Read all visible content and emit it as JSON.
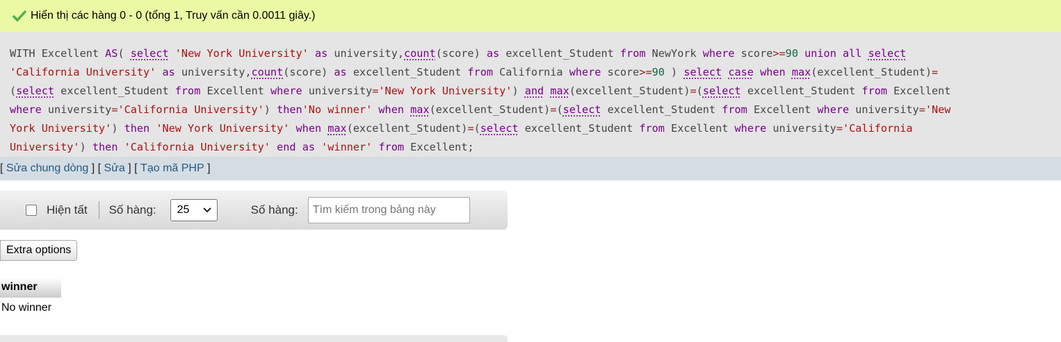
{
  "success_message": "Hiển thị các hàng 0 - 0 (tổng 1, Truy vấn cần 0.0011 giây.)",
  "sql_lines": [
    [
      [
        "p",
        "WITH Excellent "
      ],
      [
        "k",
        "AS"
      ],
      [
        "p",
        "( "
      ],
      [
        "f",
        "select"
      ],
      [
        "p",
        " "
      ],
      [
        "s",
        "'New York University'"
      ],
      [
        "p",
        " "
      ],
      [
        "k",
        "as"
      ],
      [
        "p",
        " university,"
      ],
      [
        "f",
        "count"
      ],
      [
        "p",
        "(score) "
      ],
      [
        "k",
        "as"
      ],
      [
        "p",
        " excellent_Student "
      ],
      [
        "k",
        "from"
      ],
      [
        "p",
        " NewYork "
      ],
      [
        "k",
        "where"
      ],
      [
        "p",
        " score"
      ],
      [
        "o",
        ">="
      ],
      [
        "n",
        "90"
      ],
      [
        "p",
        " "
      ],
      [
        "k",
        "union all"
      ],
      [
        "p",
        " "
      ],
      [
        "f",
        "select"
      ]
    ],
    [
      [
        "s",
        "'California University'"
      ],
      [
        "p",
        " "
      ],
      [
        "k",
        "as"
      ],
      [
        "p",
        " university,"
      ],
      [
        "f",
        "count"
      ],
      [
        "p",
        "(score) "
      ],
      [
        "k",
        "as"
      ],
      [
        "p",
        " excellent_Student "
      ],
      [
        "k",
        "from"
      ],
      [
        "p",
        " California "
      ],
      [
        "k",
        "where"
      ],
      [
        "p",
        " score"
      ],
      [
        "o",
        ">="
      ],
      [
        "n",
        "90"
      ],
      [
        "p",
        " ) "
      ],
      [
        "f",
        "select"
      ],
      [
        "p",
        " "
      ],
      [
        "f",
        "case"
      ],
      [
        "p",
        " "
      ],
      [
        "k",
        "when"
      ],
      [
        "p",
        " "
      ],
      [
        "f",
        "max"
      ],
      [
        "p",
        "(excellent_Student)"
      ],
      [
        "o",
        "="
      ]
    ],
    [
      [
        "p",
        "("
      ],
      [
        "f",
        "select"
      ],
      [
        "p",
        " excellent_Student "
      ],
      [
        "k",
        "from"
      ],
      [
        "p",
        " Excellent "
      ],
      [
        "k",
        "where"
      ],
      [
        "p",
        " university"
      ],
      [
        "o",
        "="
      ],
      [
        "s",
        "'New York University'"
      ],
      [
        "p",
        ") "
      ],
      [
        "f",
        "and"
      ],
      [
        "p",
        " "
      ],
      [
        "f",
        "max"
      ],
      [
        "p",
        "(excellent_Student)"
      ],
      [
        "o",
        "="
      ],
      [
        "p",
        "("
      ],
      [
        "f",
        "select"
      ],
      [
        "p",
        " excellent_Student "
      ],
      [
        "k",
        "from"
      ],
      [
        "p",
        " Excellent"
      ]
    ],
    [
      [
        "k",
        "where"
      ],
      [
        "p",
        " university"
      ],
      [
        "o",
        "="
      ],
      [
        "s",
        "'California University'"
      ],
      [
        "p",
        ") "
      ],
      [
        "k",
        "then"
      ],
      [
        "s",
        "'No winner'"
      ],
      [
        "p",
        " "
      ],
      [
        "k",
        "when"
      ],
      [
        "p",
        " "
      ],
      [
        "f",
        "max"
      ],
      [
        "p",
        "(excellent_Student)"
      ],
      [
        "o",
        "="
      ],
      [
        "p",
        "("
      ],
      [
        "f",
        "select"
      ],
      [
        "p",
        " excellent_Student "
      ],
      [
        "k",
        "from"
      ],
      [
        "p",
        " Excellent "
      ],
      [
        "k",
        "where"
      ],
      [
        "p",
        " university"
      ],
      [
        "o",
        "="
      ],
      [
        "s",
        "'New"
      ]
    ],
    [
      [
        "s",
        "York University'"
      ],
      [
        "p",
        ") "
      ],
      [
        "k",
        "then"
      ],
      [
        "p",
        " "
      ],
      [
        "s",
        "'New York University'"
      ],
      [
        "p",
        " "
      ],
      [
        "k",
        "when"
      ],
      [
        "p",
        " "
      ],
      [
        "f",
        "max"
      ],
      [
        "p",
        "(excellent_Student)"
      ],
      [
        "o",
        "="
      ],
      [
        "p",
        "("
      ],
      [
        "f",
        "select"
      ],
      [
        "p",
        " excellent_Student "
      ],
      [
        "k",
        "from"
      ],
      [
        "p",
        " Excellent "
      ],
      [
        "k",
        "where"
      ],
      [
        "p",
        " university"
      ],
      [
        "o",
        "="
      ],
      [
        "s",
        "'California"
      ]
    ],
    [
      [
        "s",
        "University'"
      ],
      [
        "p",
        ") "
      ],
      [
        "k",
        "then"
      ],
      [
        "p",
        " "
      ],
      [
        "s",
        "'California University'"
      ],
      [
        "p",
        " "
      ],
      [
        "k",
        "end"
      ],
      [
        "p",
        " "
      ],
      [
        "k",
        "as"
      ],
      [
        "p",
        " "
      ],
      [
        "s",
        "'winner'"
      ],
      [
        "p",
        " "
      ],
      [
        "k",
        "from"
      ],
      [
        "p",
        " Excellent;"
      ]
    ]
  ],
  "links": {
    "edit_inline": "Sửa chung dòng",
    "edit": "Sửa",
    "create_php": "Tạo mã PHP"
  },
  "nav": {
    "show_all": "Hiện tất",
    "rows_label": "Số hàng:",
    "rows_value": "25",
    "filter_label": "Số hàng:",
    "search_placeholder": "Tìm kiếm trong bảng này"
  },
  "extra_options": "Extra options",
  "results": {
    "columns": [
      "winner"
    ],
    "rows": [
      [
        "No winner"
      ]
    ]
  }
}
